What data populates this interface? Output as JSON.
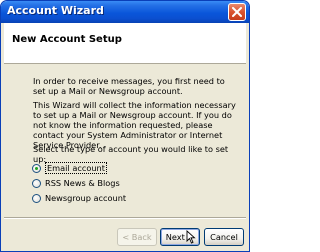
{
  "window": {
    "title": "Account Wizard",
    "close_icon": "close-icon"
  },
  "header": {
    "title": "New Account Setup"
  },
  "body": {
    "intro": "In order to receive messages, you first need to set up a Mail or Newsgroup account.",
    "info": "This Wizard will collect the information necessary to set up a Mail or Newsgroup account. If you do not know the information requested, please contact your System Administrator or Internet Service Provider.",
    "prompt": "Select the type of account you would like to set up:"
  },
  "account_types": {
    "selected": "Email account",
    "options": [
      {
        "label": "Email account",
        "checked": true
      },
      {
        "label": "RSS News & Blogs",
        "checked": false
      },
      {
        "label": "Newsgroup account",
        "checked": false
      }
    ]
  },
  "buttons": {
    "back": "< Back",
    "next": "Next >",
    "cancel": "Cancel"
  },
  "colors": {
    "titlebar": "#0a56da",
    "dialog_bg": "#ece9d8",
    "radio_dot": "#21a121"
  }
}
